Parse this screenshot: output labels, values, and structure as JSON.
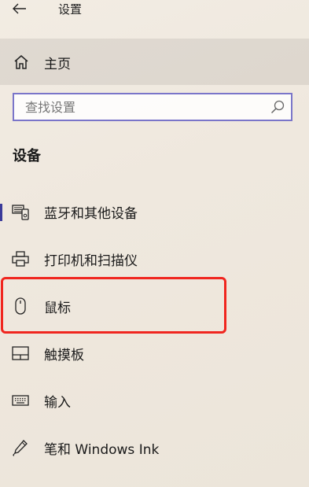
{
  "window": {
    "title": "设置"
  },
  "home": {
    "label": "主页"
  },
  "search": {
    "placeholder": "查找设置"
  },
  "section": {
    "title": "设备"
  },
  "nav_items": [
    {
      "label": "蓝牙和其他设备",
      "icon": "bluetooth-devices-icon"
    },
    {
      "label": "打印机和扫描仪",
      "icon": "printer-icon"
    },
    {
      "label": "鼠标",
      "icon": "mouse-icon"
    },
    {
      "label": "触摸板",
      "icon": "touchpad-icon"
    },
    {
      "label": "输入",
      "icon": "keyboard-icon"
    },
    {
      "label": "笔和 Windows Ink",
      "icon": "pen-icon"
    }
  ],
  "colors": {
    "accent": "#3b3b9a",
    "highlight": "#f0261f",
    "search_border": "#7a75c9"
  }
}
